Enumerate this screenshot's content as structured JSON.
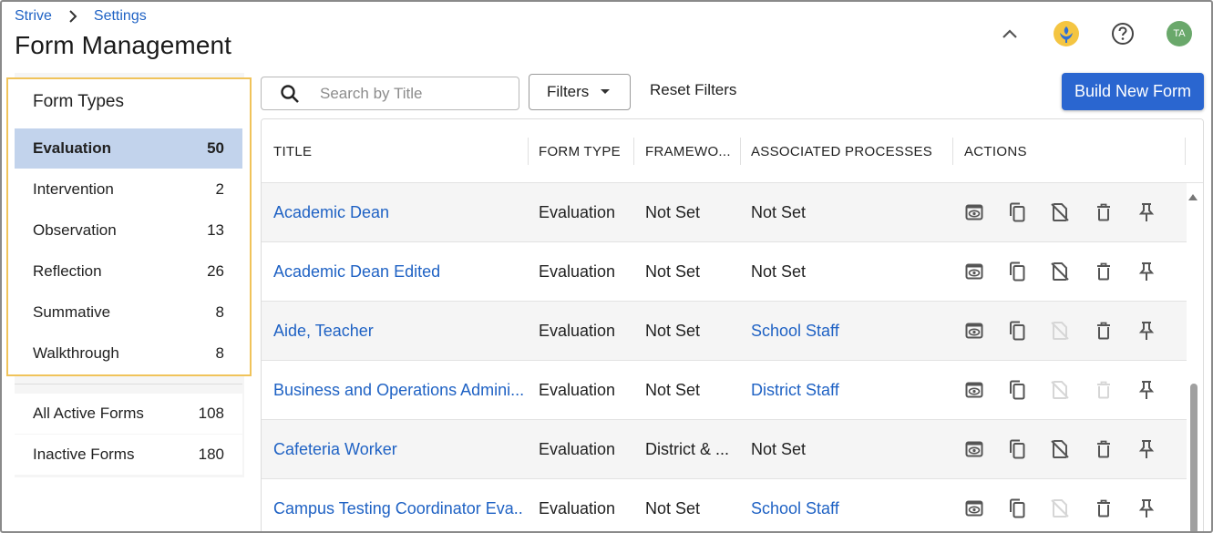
{
  "breadcrumb": {
    "root": "Strive",
    "current": "Settings"
  },
  "page_title": "Form Management",
  "header_icons": {
    "collapse": "chevron-up-icon",
    "logo": "strive-logo-icon",
    "help": "help-icon",
    "avatar_initials": "TA"
  },
  "sidebar": {
    "title": "Form Types",
    "types": [
      {
        "label": "Evaluation",
        "count": "50",
        "active": true
      },
      {
        "label": "Intervention",
        "count": "2"
      },
      {
        "label": "Observation",
        "count": "13"
      },
      {
        "label": "Reflection",
        "count": "26"
      },
      {
        "label": "Summative",
        "count": "8"
      },
      {
        "label": "Walkthrough",
        "count": "8"
      }
    ],
    "other": [
      {
        "label": "All Active Forms",
        "count": "108"
      },
      {
        "label": "Inactive Forms",
        "count": "180"
      }
    ]
  },
  "toolbar": {
    "search_placeholder": "Search by Title",
    "filters_label": "Filters",
    "reset_label": "Reset Filters",
    "build_label": "Build New Form"
  },
  "table": {
    "columns": [
      "TITLE",
      "FORM TYPE",
      "FRAMEWO...",
      "ASSOCIATED PROCESSES",
      "ACTIONS"
    ],
    "rows": [
      {
        "title": "Academic Dean",
        "type": "Evaluation",
        "framework": "Not Set",
        "processes": "Not Set",
        "processes_link": false,
        "unlink_enabled": true,
        "delete_enabled": true
      },
      {
        "title": "Academic Dean Edited",
        "type": "Evaluation",
        "framework": "Not Set",
        "processes": "Not Set",
        "processes_link": false,
        "unlink_enabled": true,
        "delete_enabled": true
      },
      {
        "title": "Aide, Teacher",
        "type": "Evaluation",
        "framework": "Not Set",
        "processes": "School Staff",
        "processes_link": true,
        "unlink_enabled": false,
        "delete_enabled": true
      },
      {
        "title": "Business and Operations Admini...",
        "type": "Evaluation",
        "framework": "Not Set",
        "processes": "District Staff",
        "processes_link": true,
        "unlink_enabled": false,
        "delete_enabled": false
      },
      {
        "title": "Cafeteria Worker",
        "type": "Evaluation",
        "framework": "District & ...",
        "processes": "Not Set",
        "processes_link": false,
        "unlink_enabled": true,
        "delete_enabled": true
      },
      {
        "title": "Campus Testing Coordinator Eva...",
        "type": "Evaluation",
        "framework": "Not Set",
        "processes": "School Staff",
        "processes_link": true,
        "unlink_enabled": false,
        "delete_enabled": true
      }
    ],
    "action_icons": [
      "preview-icon",
      "copy-icon",
      "unlink-icon",
      "delete-icon",
      "pin-icon"
    ]
  },
  "colors": {
    "accent": "#2a66d0",
    "link": "#1f62c4",
    "active_row": "#c2d3ec",
    "highlight_border": "#f0c35a"
  }
}
